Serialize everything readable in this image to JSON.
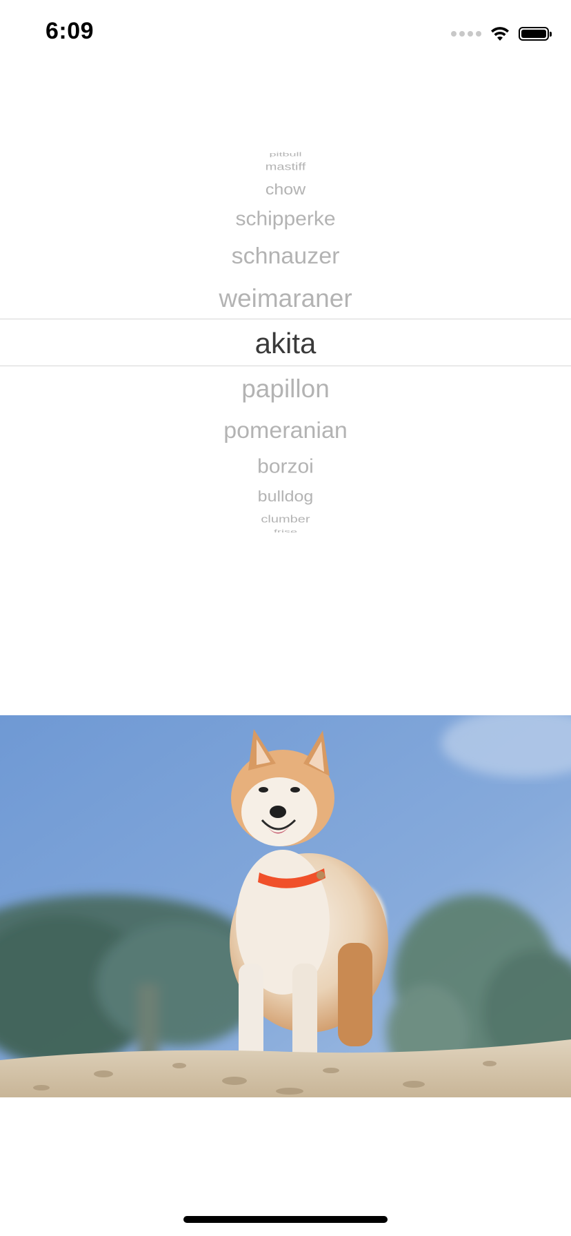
{
  "status_bar": {
    "time": "6:09",
    "icons": [
      "cellular-signal-icon",
      "wifi-icon",
      "battery-icon"
    ]
  },
  "picker": {
    "items": [
      "pitbull",
      "mastiff",
      "chow",
      "schipperke",
      "schnauzer",
      "weimaraner",
      "akita",
      "papillon",
      "pomeranian",
      "borzoi",
      "bulldog",
      "clumber",
      "frise"
    ],
    "selected": "akita",
    "selected_index": 6
  },
  "photo": {
    "subject": "akita dog standing on sand against blue sky",
    "colors": {
      "sky": "#7aa2d8",
      "sand": "#d8c9b1",
      "collar": "#f0502a",
      "fur": "#e6b383"
    }
  }
}
